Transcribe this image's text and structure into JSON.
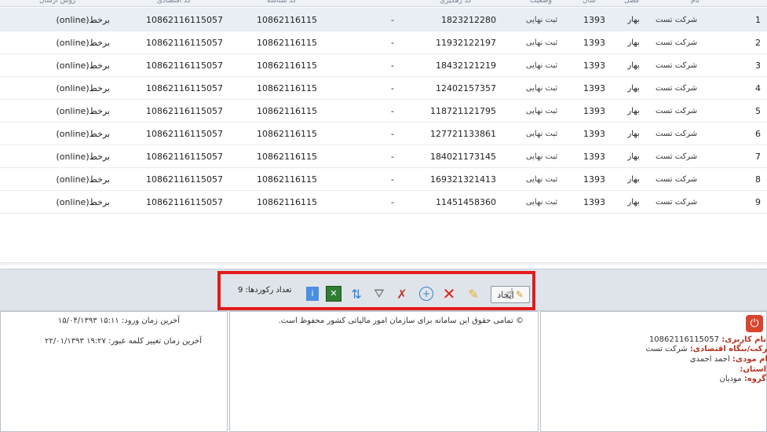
{
  "grid": {
    "headers": [
      "",
      "نام",
      "فصل",
      "سال",
      "وضعیت",
      "کد رهگیری",
      "",
      "کد شناسه",
      "کد اقتصادی",
      "روش ارسال"
    ],
    "rows": [
      {
        "idx": "1",
        "company": "شرکت تست",
        "season": "بهار",
        "year": "1393",
        "status": "ثبت نهایی",
        "tracking": "1823212280",
        "dash": "-",
        "code": "10862116115",
        "ecode": "10862116115057",
        "method": "(online)برخط",
        "selected": true
      },
      {
        "idx": "2",
        "company": "شرکت تست",
        "season": "بهار",
        "year": "1393",
        "status": "ثبت نهایی",
        "tracking": "11932122197",
        "dash": "-",
        "code": "10862116115",
        "ecode": "10862116115057",
        "method": "(online)برخط",
        "selected": false
      },
      {
        "idx": "3",
        "company": "شرکت تست",
        "season": "بهار",
        "year": "1393",
        "status": "ثبت نهایی",
        "tracking": "18432121219",
        "dash": "-",
        "code": "10862116115",
        "ecode": "10862116115057",
        "method": "(online)برخط",
        "selected": false
      },
      {
        "idx": "4",
        "company": "شرکت تست",
        "season": "بهار",
        "year": "1393",
        "status": "ثبت نهایی",
        "tracking": "12402157357",
        "dash": "-",
        "code": "10862116115",
        "ecode": "10862116115057",
        "method": "(online)برخط",
        "selected": false
      },
      {
        "idx": "5",
        "company": "شرکت تست",
        "season": "بهار",
        "year": "1393",
        "status": "ثبت نهایی",
        "tracking": "118721121795",
        "dash": "-",
        "code": "10862116115",
        "ecode": "10862116115057",
        "method": "(online)برخط",
        "selected": false
      },
      {
        "idx": "6",
        "company": "شرکت تست",
        "season": "بهار",
        "year": "1393",
        "status": "ثبت نهایی",
        "tracking": "127721133861",
        "dash": "-",
        "code": "10862116115",
        "ecode": "10862116115057",
        "method": "(online)برخط",
        "selected": false
      },
      {
        "idx": "7",
        "company": "شرکت تست",
        "season": "بهار",
        "year": "1393",
        "status": "ثبت نهایی",
        "tracking": "184021173145",
        "dash": "-",
        "code": "10862116115",
        "ecode": "10862116115057",
        "method": "(online)برخط",
        "selected": false
      },
      {
        "idx": "8",
        "company": "شرکت تست",
        "season": "بهار",
        "year": "1393",
        "status": "ثبت نهایی",
        "tracking": "169321321413",
        "dash": "-",
        "code": "10862116115",
        "ecode": "10862116115057",
        "method": "(online)برخط",
        "selected": false
      },
      {
        "idx": "9",
        "company": "شرکت تست",
        "season": "بهار",
        "year": "1393",
        "status": "ثبت نهایی",
        "tracking": "11451458360",
        "dash": "-",
        "code": "10862116115",
        "ecode": "10862116115057",
        "method": "(online)برخط",
        "selected": false
      }
    ]
  },
  "toolbar": {
    "record_count_label": "تعداد رکوردها: 9",
    "create_label": "ایجاد",
    "icons": [
      "info-icon",
      "excel-export-icon",
      "refresh-icon",
      "filter-icon",
      "clear-filter-icon",
      "view-icon",
      "delete-icon",
      "edit-icon"
    ],
    "highlight_color": "#e11b1b"
  },
  "footer": {
    "last_login_label": "آخرین زمان ورود:",
    "last_login_value": "۱۵:۱۱ ۱۵/۰۴/۱۳۹۳",
    "last_password_label": "آخرین زمان تغییر کلمه عبور:",
    "last_password_value": "۱۹:۲۷ ۲۲/۰۱/۱۳۹۳",
    "copyright": "© تمامی حقوق این سامانه برای سازمان امور مالیاتی کشور محفوظ است.",
    "username_label": "نام کاربری:",
    "username_value": "10862116115057",
    "company_label": "نام شرکت/بنگاه اقتصادی:",
    "company_value": "شرکت تست",
    "fullname_label": "نام مودی:",
    "fullname_value": "احمد احمدی",
    "province_label": "استان:",
    "province_value": "",
    "group_label": "گروه:",
    "group_value": "مودیان"
  }
}
